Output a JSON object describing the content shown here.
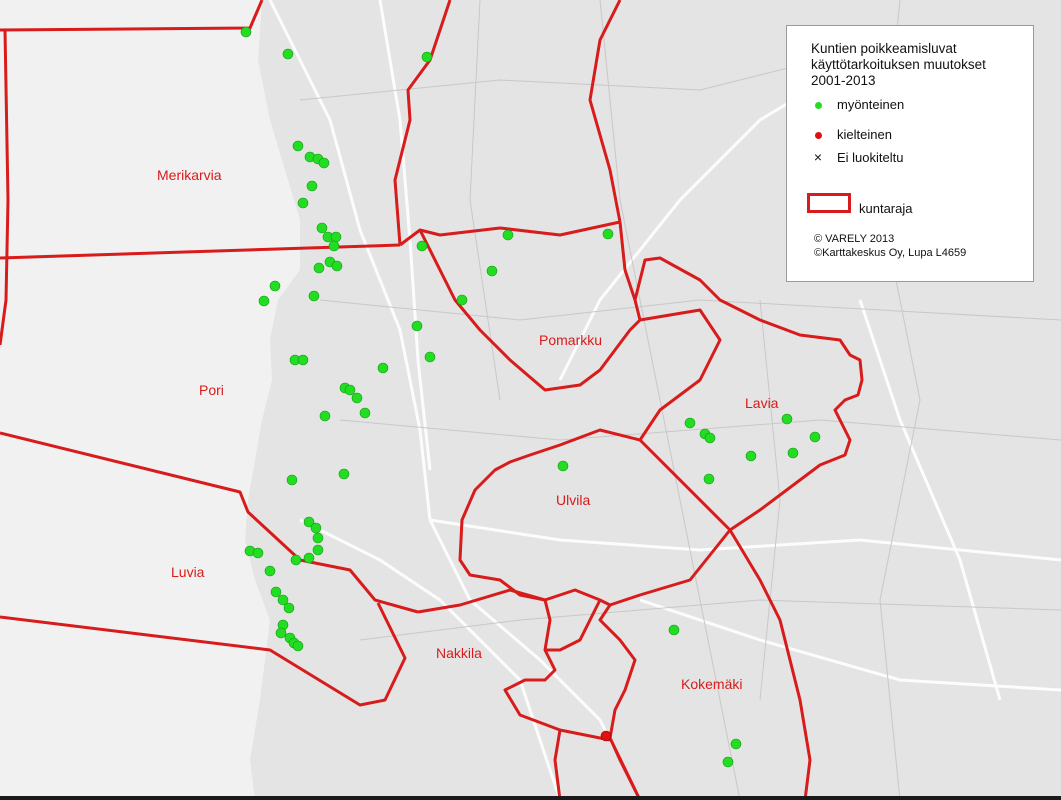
{
  "colors": {
    "boundary": "#d81b1b",
    "positive": "#22dd22",
    "negative": "#dd1111",
    "land": "#e4e4e4",
    "sea": "#f1f1f1"
  },
  "municipalities": [
    {
      "id": "merikarvia",
      "name": "Merikarvia"
    },
    {
      "id": "pori",
      "name": "Pori"
    },
    {
      "id": "luvia",
      "name": "Luvia"
    },
    {
      "id": "pomarkku",
      "name": "Pomarkku"
    },
    {
      "id": "ulvila",
      "name": "Ulvila"
    },
    {
      "id": "lavia",
      "name": "Lavia"
    },
    {
      "id": "nakkila",
      "name": "Nakkila"
    },
    {
      "id": "kokemaki",
      "name": "Kokemäki"
    }
  ],
  "legend": {
    "title_lines": [
      "Kuntien poikkeamisluvat",
      "käyttötarkoituksen muutokset",
      "2001-2013"
    ],
    "items": [
      {
        "symbol": "green-dot",
        "label": "myönteinen"
      },
      {
        "symbol": "red-dot",
        "label": "kielteinen"
      },
      {
        "symbol": "cross",
        "label": "Ei luokiteltu"
      }
    ],
    "boundary_label": "kuntaraja",
    "credits": [
      "© VARELY 2013",
      "©Karttakeskus Oy, Lupa L4659"
    ]
  }
}
